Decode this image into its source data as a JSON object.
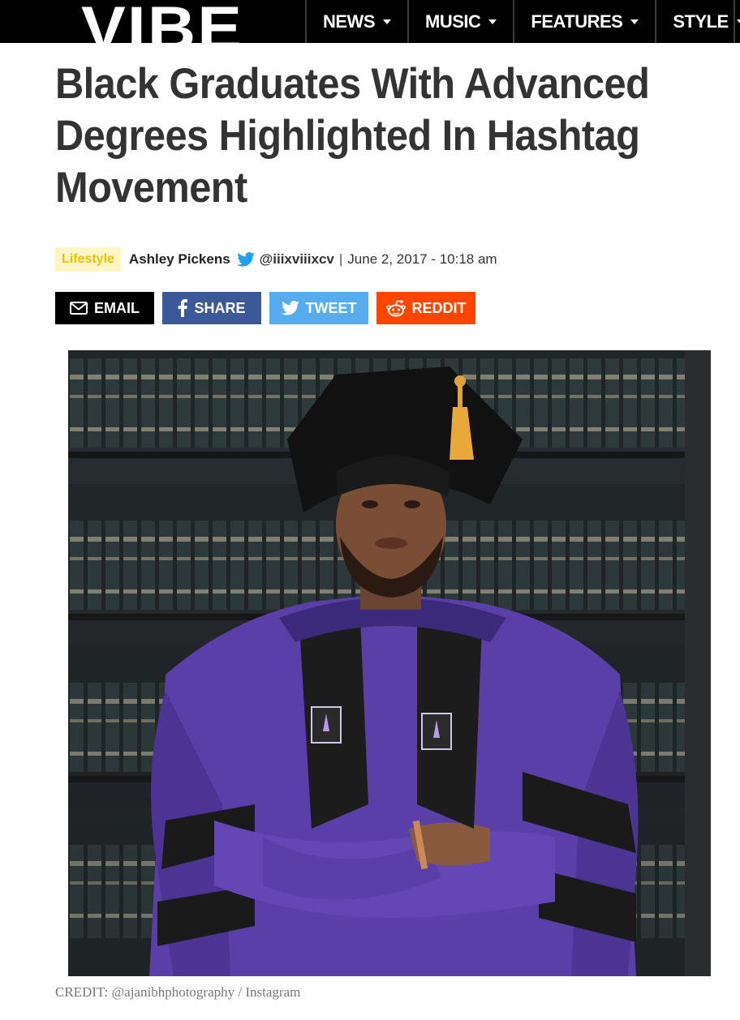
{
  "header": {
    "logo_text": "VIBE",
    "nav": [
      {
        "label": "NEWS"
      },
      {
        "label": "MUSIC"
      },
      {
        "label": "FEATURES"
      },
      {
        "label": "STYLE"
      }
    ]
  },
  "article": {
    "title": "Black Graduates With Advanced Degrees Highlighted In Hashtag Movement",
    "category": "Lifestyle",
    "author": "Ashley Pickens",
    "twitter_handle": "@iiixviiixcv",
    "separator": "|",
    "date": "June 2, 2017 - 10:18 am",
    "image_credit": "CREDIT: @ajanibhphotography / Instagram"
  },
  "share": {
    "email": "EMAIL",
    "facebook": "SHARE",
    "twitter": "TWEET",
    "reddit": "REDDIT"
  },
  "colors": {
    "brand_black": "#000000",
    "facebook": "#3b5998",
    "twitter": "#55acee",
    "reddit": "#ff4500",
    "tag_bg": "#fdf5c4",
    "tag_text": "#e8c20a",
    "robe_purple": "#5a3fa8"
  },
  "icons": [
    "envelope-icon",
    "facebook-icon",
    "twitter-bird-icon",
    "reddit-icon",
    "chevron-down-icon"
  ]
}
